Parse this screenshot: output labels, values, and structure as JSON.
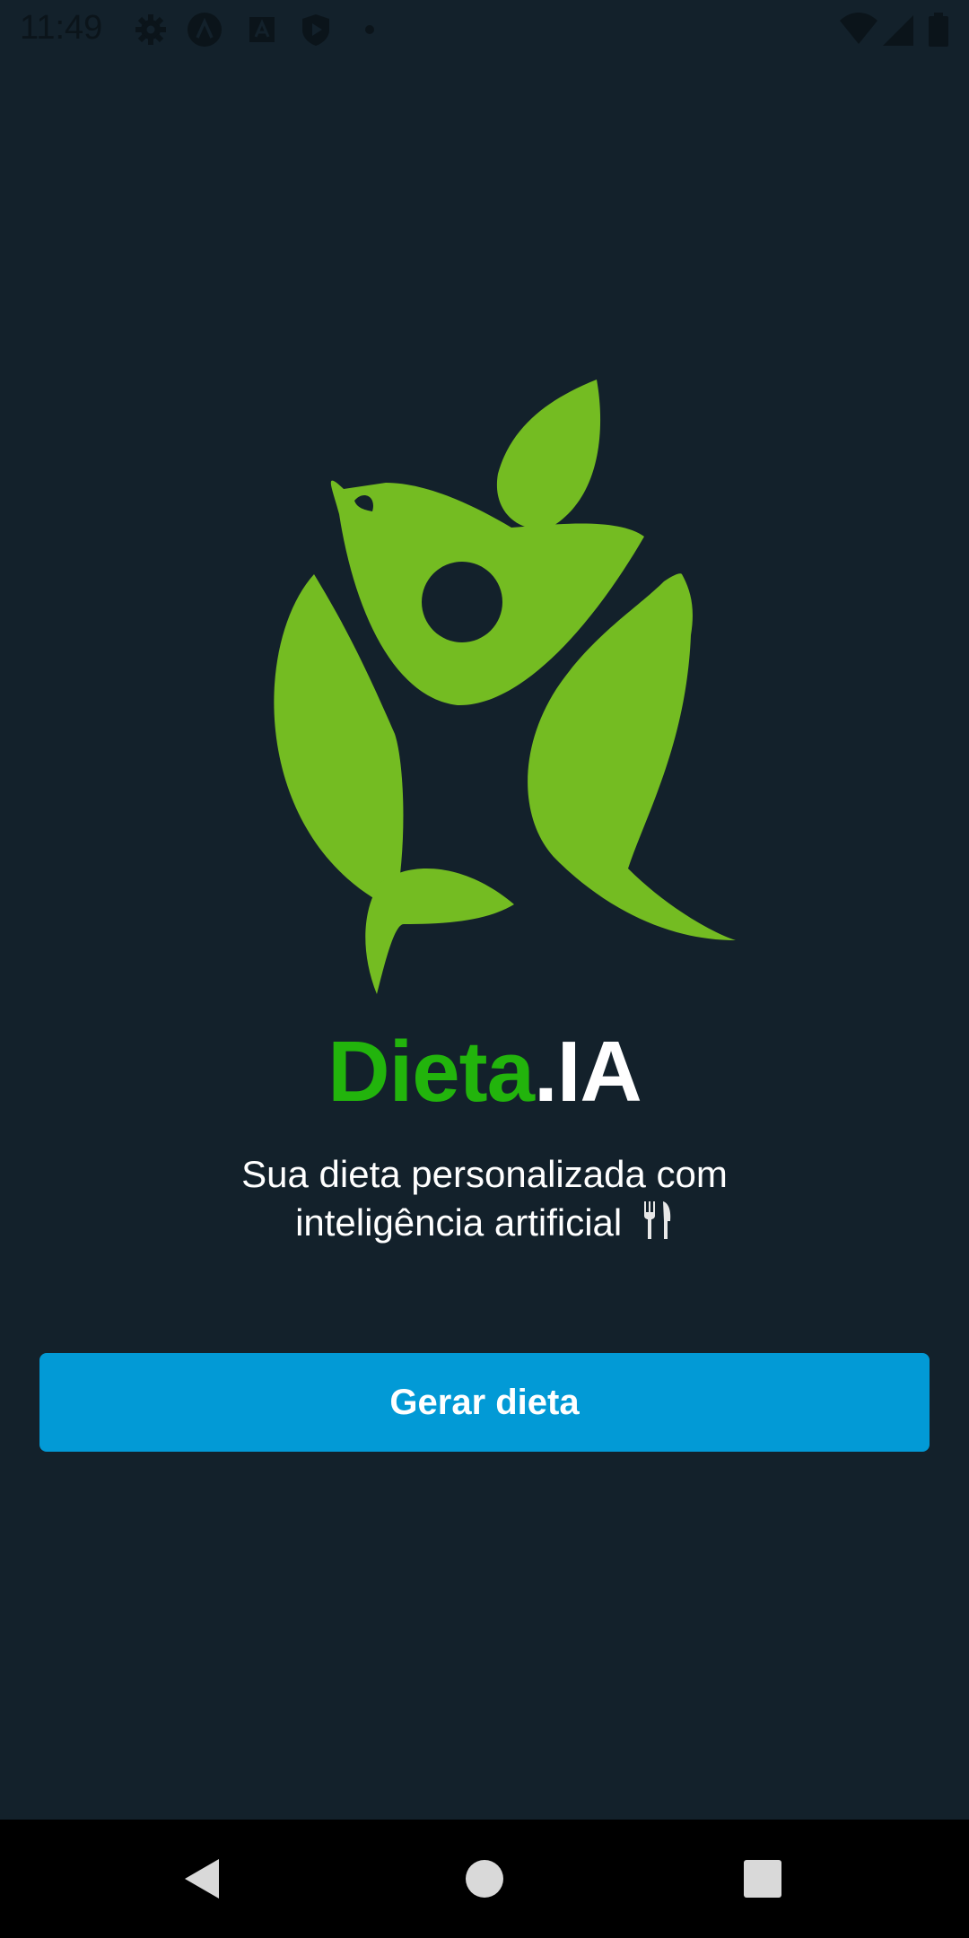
{
  "status_bar": {
    "time": "11:49",
    "icons": [
      "gear-icon",
      "app-a-icon",
      "font-a-icon",
      "play-shield-icon",
      "dot-icon",
      "wifi-icon",
      "signal-icon",
      "battery-icon"
    ]
  },
  "brand": {
    "title_part1": "Dieta",
    "title_part2": ".IA",
    "title_green": "#22b40c",
    "logo_green": "#74bc22"
  },
  "hero": {
    "subtitle_line1": "Sua dieta personalizada com",
    "subtitle_line2": "inteligência artificial",
    "subtitle_icon": "fork-knife-icon"
  },
  "actions": {
    "generate_label": "Gerar dieta",
    "button_color": "#029ad6"
  },
  "nav_bar": {
    "buttons": [
      "back-icon",
      "home-icon",
      "recents-icon"
    ]
  }
}
